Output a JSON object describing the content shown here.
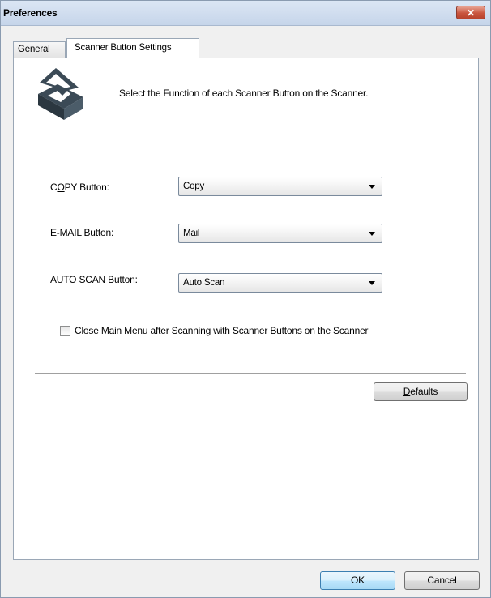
{
  "window": {
    "title": "Preferences",
    "close_label": "✕"
  },
  "tabs": [
    {
      "label": "General"
    },
    {
      "label": "Scanner Button Settings"
    }
  ],
  "intro_text": "Select the Function of each Scanner Button on the Scanner.",
  "fields": {
    "copy": {
      "label_pre": "C",
      "label_u": "O",
      "label_post": "PY Button:",
      "value": "Copy"
    },
    "email": {
      "label_pre": "E-",
      "label_u": "M",
      "label_post": "AIL Button:",
      "value": "Mail"
    },
    "autoscan": {
      "label_pre": "AUTO ",
      "label_u": "S",
      "label_post": "CAN Button:",
      "value": "Auto Scan"
    }
  },
  "close_menu": {
    "checked": false,
    "label_u": "C",
    "label_rest": "lose Main Menu after Scanning with Scanner Buttons on the Scanner"
  },
  "buttons": {
    "defaults_u": "D",
    "defaults_rest": "efaults",
    "ok": "OK",
    "cancel": "Cancel"
  },
  "colors": {
    "titlebar": "#c6d5ea",
    "close_button": "#c9553e",
    "ok_border": "#3c7fb1"
  },
  "icons": [
    "scanner-icon",
    "dropdown-arrow-icon",
    "close-icon"
  ]
}
